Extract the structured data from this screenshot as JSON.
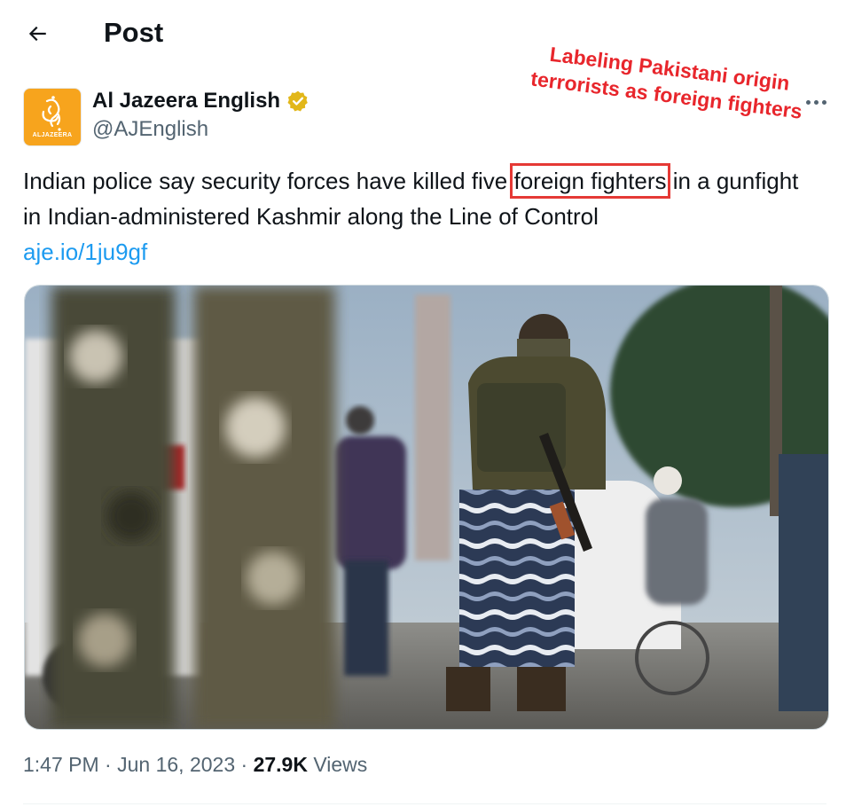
{
  "header": {
    "title": "Post"
  },
  "author": {
    "name": "Al Jazeera English",
    "handle": "@AJEnglish",
    "avatar_label": "ALJAZEERA",
    "verified": true
  },
  "annotation": {
    "line1": "Labeling Pakistani origin",
    "line2": "terrorists as foreign fighters"
  },
  "tweet": {
    "text_before": "Indian police say security forces have killed five ",
    "highlighted": "foreign fighters",
    "text_after": " in a gunfight in Indian-administered Kashmir along the Line of Control",
    "link": "aje.io/1ju9gf"
  },
  "meta": {
    "time": "1:47 PM",
    "sep1": " · ",
    "date": "Jun 16, 2023",
    "sep2": " · ",
    "views_count": "27.9K",
    "views_label": " Views"
  },
  "colors": {
    "brand": "#f7a41d",
    "link": "#1d9bf0",
    "annotation": "#e8262c",
    "verified": "#e2b719"
  },
  "icons": {
    "back": "arrow-left-icon",
    "verified": "verified-badge-icon",
    "more": "more-horizontal-icon"
  }
}
